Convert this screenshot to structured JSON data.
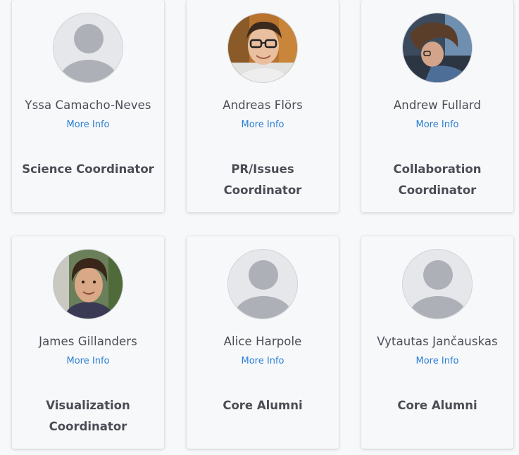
{
  "people": [
    {
      "name": "Yssa Camacho-Neves",
      "more_info": "More Info",
      "role": "Science Coordinator",
      "avatar": "default-avatar-icon"
    },
    {
      "name": "Andreas Flörs",
      "more_info": "More Info",
      "role": "PR/Issues Coordinator",
      "avatar": "photo-andreas"
    },
    {
      "name": "Andrew Fullard",
      "more_info": "More Info",
      "role": "Collaboration Coordinator",
      "avatar": "photo-andrew"
    },
    {
      "name": "James Gillanders",
      "more_info": "More Info",
      "role": "Visualization Coordinator",
      "avatar": "photo-james"
    },
    {
      "name": "Alice Harpole",
      "more_info": "More Info",
      "role": "Core Alumni",
      "avatar": "default-avatar-icon"
    },
    {
      "name": "Vytautas Jančauskas",
      "more_info": "More Info",
      "role": "Core Alumni",
      "avatar": "default-avatar-icon"
    }
  ],
  "colors": {
    "link": "#2a7ed3",
    "text": "#4a4d55",
    "avatar_bg": "#e6e7ea",
    "avatar_fg": "#aeb0b7"
  }
}
